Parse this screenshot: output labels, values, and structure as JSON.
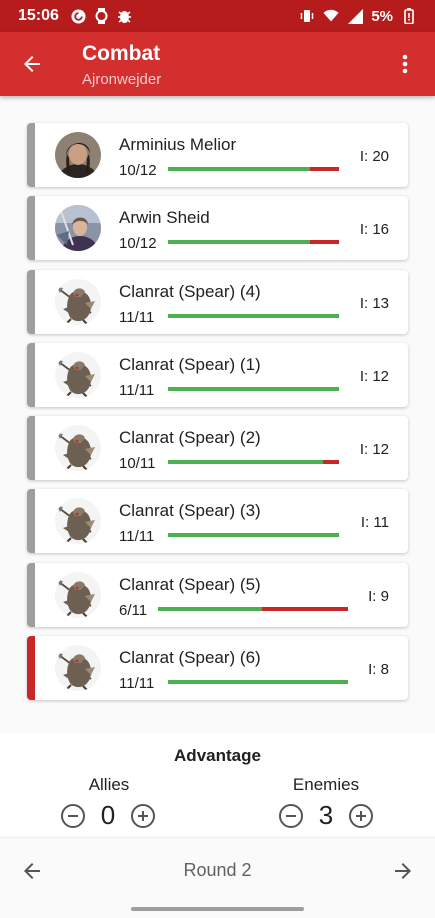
{
  "status_bar": {
    "time": "15:06",
    "battery": "5%",
    "left_icons": [
      "pocket-casts-icon",
      "watch-icon",
      "android-bug-icon"
    ],
    "right_icons": [
      "vibrate-icon",
      "wifi-icon",
      "signal-icon",
      "battery-icon"
    ]
  },
  "app_bar": {
    "title": "Combat",
    "subtitle": "Ajronwejder",
    "back_icon": "arrow-back-icon",
    "menu_icon": "more-vert-icon"
  },
  "colors": {
    "primary": "#d32f2f",
    "primary_dark": "#b71c1c",
    "health_good": "#4caf50",
    "health_lost": "#c62828",
    "inactive_stripe": "#9e9e9e",
    "active_stripe": "#c62828"
  },
  "combatants": [
    {
      "name": "Arminius Melior",
      "hp": "10/12",
      "initiative": "I: 20",
      "hp_fraction": 0.833,
      "avatar": "arminius-portrait",
      "active": false
    },
    {
      "name": "Arwin Sheid",
      "hp": "10/12",
      "initiative": "I: 16",
      "hp_fraction": 0.833,
      "avatar": "arwin-portrait",
      "active": false
    },
    {
      "name": "Clanrat (Spear) (4)",
      "hp": "11/11",
      "initiative": "I: 13",
      "hp_fraction": 1.0,
      "avatar": "clanrat-portrait",
      "active": false
    },
    {
      "name": "Clanrat (Spear) (1)",
      "hp": "11/11",
      "initiative": "I: 12",
      "hp_fraction": 1.0,
      "avatar": "clanrat-portrait",
      "active": false
    },
    {
      "name": "Clanrat (Spear) (2)",
      "hp": "10/11",
      "initiative": "I: 12",
      "hp_fraction": 0.909,
      "avatar": "clanrat-portrait",
      "active": false
    },
    {
      "name": "Clanrat (Spear) (3)",
      "hp": "11/11",
      "initiative": "I: 11",
      "hp_fraction": 1.0,
      "avatar": "clanrat-portrait",
      "active": false
    },
    {
      "name": "Clanrat (Spear) (5)",
      "hp": "6/11",
      "initiative": "I: 9",
      "hp_fraction": 0.545,
      "avatar": "clanrat-portrait",
      "active": false
    },
    {
      "name": "Clanrat (Spear) (6)",
      "hp": "11/11",
      "initiative": "I: 8",
      "hp_fraction": 1.0,
      "avatar": "clanrat-portrait",
      "active": true
    }
  ],
  "advantage": {
    "title": "Advantage",
    "allies_label": "Allies",
    "allies_value": "0",
    "enemies_label": "Enemies",
    "enemies_value": "3"
  },
  "round_nav": {
    "label": "Round 2",
    "prev_icon": "arrow-left-icon",
    "next_icon": "arrow-right-icon"
  }
}
